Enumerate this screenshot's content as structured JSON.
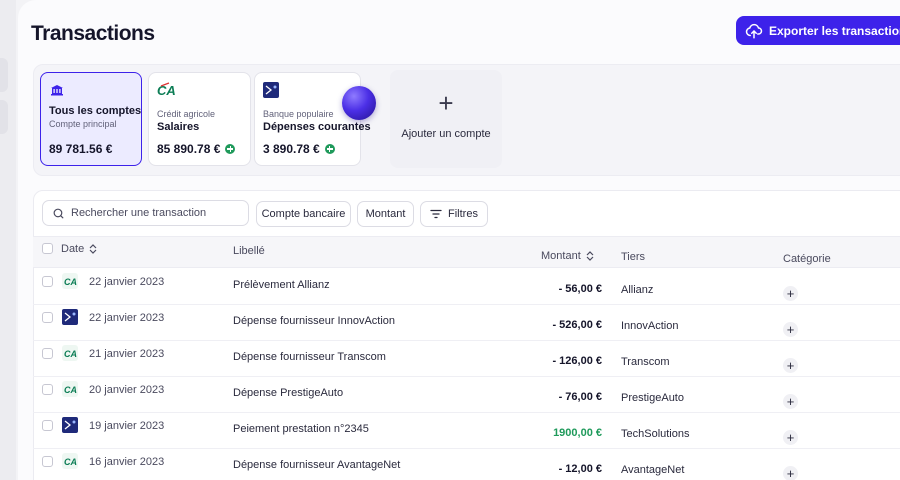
{
  "header": {
    "title": "Transactions",
    "export_label": "Exporter les transactions",
    "export_icon": "cloud-upload-icon"
  },
  "accounts": [
    {
      "bank": "",
      "name": "Tous les comptes",
      "sub": "Compte principal",
      "amount": "89 781.56 €",
      "active": true,
      "logo": "bank-icon"
    },
    {
      "bank": "Crédit agricole",
      "name": "Salaires",
      "sub": "",
      "amount": "85 890.78 €",
      "active": false,
      "logo": "credit-agricole-logo"
    },
    {
      "bank": "Banque populaire",
      "name": "Dépenses courantes",
      "sub": "",
      "amount": "3 890.78 €",
      "active": false,
      "logo": "banque-populaire-logo"
    }
  ],
  "add_account": {
    "symbol": "+",
    "label": "Ajouter un compte"
  },
  "toolbar": {
    "search_placeholder": "Rechercher une transaction",
    "chip_account": "Compte bancaire",
    "chip_amount": "Montant",
    "chip_filters": "Filtres"
  },
  "table": {
    "headers": {
      "date": "Date",
      "label": "Libellé",
      "amount": "Montant",
      "party": "Tiers",
      "category": "Catégorie"
    },
    "rows": [
      {
        "bank": "ca",
        "date": "22 janvier 2023",
        "label": "Prélèvement Allianz",
        "amount": "- 56,00 €",
        "positive": false,
        "party": "Allianz"
      },
      {
        "bank": "bp",
        "date": "22 janvier 2023",
        "label": "Dépense fournisseur InnovAction",
        "amount": "- 526,00 €",
        "positive": false,
        "party": "InnovAction"
      },
      {
        "bank": "ca",
        "date": "21 janvier 2023",
        "label": "Dépense fournisseur Transcom",
        "amount": "- 126,00 €",
        "positive": false,
        "party": "Transcom"
      },
      {
        "bank": "ca",
        "date": "20 janvier 2023",
        "label": "Dépense PrestigeAuto",
        "amount": "- 76,00 €",
        "positive": false,
        "party": "PrestigeAuto"
      },
      {
        "bank": "bp",
        "date": "19 janvier 2023",
        "label": "Peiement prestation n°2345",
        "amount": "1900,00 €",
        "positive": true,
        "party": "TechSolutions"
      },
      {
        "bank": "ca",
        "date": "16 janvier 2023",
        "label": "Dépense fournisseur AvantageNet",
        "amount": "- 12,00 €",
        "positive": false,
        "party": "AvantageNet"
      }
    ],
    "add_category_symbol": "+"
  },
  "colors": {
    "accent": "#3d22ea",
    "positive": "#1f9a5b",
    "ca_green": "#0c7d55",
    "bp_navy": "#1f2a7a"
  }
}
